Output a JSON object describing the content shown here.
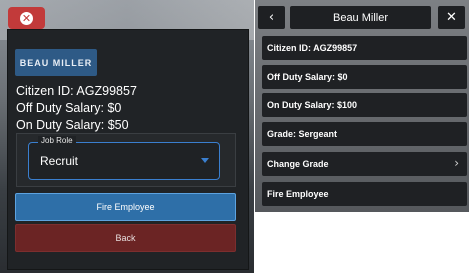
{
  "left_menu": {
    "close_icon": "close-icon",
    "employee_name": "BEAU MILLER",
    "citizen_id_line": "Citizen ID: AGZ99857",
    "off_duty_line": "Off Duty Salary: $0",
    "on_duty_line": "On Duty Salary: $50",
    "job_role": {
      "label": "Job Role",
      "value": "Recruit"
    },
    "fire_button": "Fire Employee",
    "back_button": "Back"
  },
  "right_menu": {
    "back_icon": "chevron-left-icon",
    "title": "Beau Miller",
    "close_icon": "close-icon",
    "rows": [
      {
        "label": "Citizen ID: AGZ99857"
      },
      {
        "label": "Off Duty Salary: $0"
      },
      {
        "label": "On Duty Salary: $100"
      },
      {
        "label": "Grade: Sergeant"
      },
      {
        "label": "Change Grade",
        "icon": "chevron-right-icon"
      },
      {
        "label": "Fire Employee"
      }
    ]
  },
  "colors": {
    "accent_blue": "#2e6fa8",
    "danger_red": "#c23a3a",
    "panel_dark": "#202326"
  }
}
